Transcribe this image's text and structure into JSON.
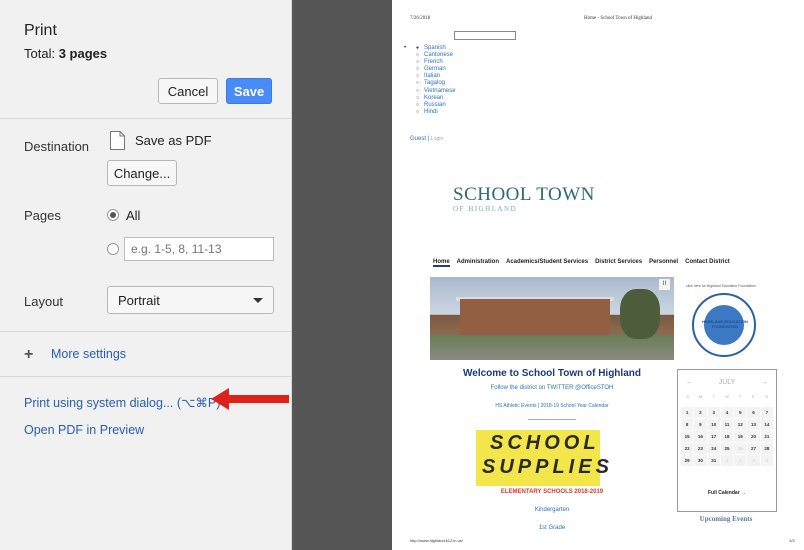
{
  "dialog": {
    "title": "Print",
    "total_label": "Total: ",
    "total_value": "3 pages",
    "cancel_label": "Cancel",
    "save_label": "Save",
    "destination_label": "Destination",
    "destination_value": "Save as PDF",
    "change_label": "Change...",
    "pages_label": "Pages",
    "pages_all": "All",
    "pages_placeholder": "e.g. 1-5, 8, 11-13",
    "layout_label": "Layout",
    "layout_value": "Portrait",
    "more_settings": "More settings",
    "system_dialog": "Print using system dialog... (⌥⌘P)",
    "open_preview": "Open PDF in Preview",
    "save_color": "#4a8cf7",
    "arrow_color": "#e0201b"
  },
  "preview": {
    "date": "7/26/2018",
    "header": "Home - School Town of Highland",
    "languages": [
      "Spanish",
      "Cantonese",
      "French",
      "German",
      "Italian",
      "Tagalog",
      "Vietnamese",
      "Korean",
      "Russian",
      "Hindi"
    ],
    "guest": "Guest",
    "login": "Login",
    "logo_main": "SCHOOL TOWN",
    "logo_sub": "OF HIGHLAND",
    "nav": [
      "Home",
      "Administration",
      "Academics/Student Services",
      "District Services",
      "Personnel",
      "Contact District"
    ],
    "foundation_note": "click here for Highland Education Foundation",
    "seal_text": "HIGHLAND EDUCATION FOUNDATION",
    "welcome": "Welcome to School Town of Highland",
    "follow": "Follow the district on TWITTER  @OfficeSTOH",
    "events_line": "HS Athletic Events  | 2018-19 School Year Calendar",
    "supplies_1": "SCHOOL",
    "supplies_2": "SUPPLIES",
    "elementary": "ELEMENTARY SCHOOLS 2018-2019",
    "kindergarten": "Kindergarten",
    "first_grade": "1st Grade",
    "calendar": {
      "month": "JULY",
      "prev": "←",
      "next": "→",
      "dow": [
        "S",
        "M",
        "T",
        "W",
        "T",
        "F",
        "S"
      ],
      "days": [
        "1",
        "2",
        "3",
        "4",
        "5",
        "6",
        "7",
        "8",
        "9",
        "10",
        "11",
        "12",
        "13",
        "14",
        "15",
        "16",
        "17",
        "18",
        "19",
        "20",
        "21",
        "22",
        "23",
        "24",
        "25",
        "26",
        "27",
        "28",
        "29",
        "30",
        "31",
        "1",
        "2",
        "3",
        "4"
      ],
      "full_calendar": "Full Calendar →"
    },
    "upcoming": "Upcoming Events",
    "url": "http://www.highland.k12.in.us/",
    "page_num": "1/3"
  }
}
